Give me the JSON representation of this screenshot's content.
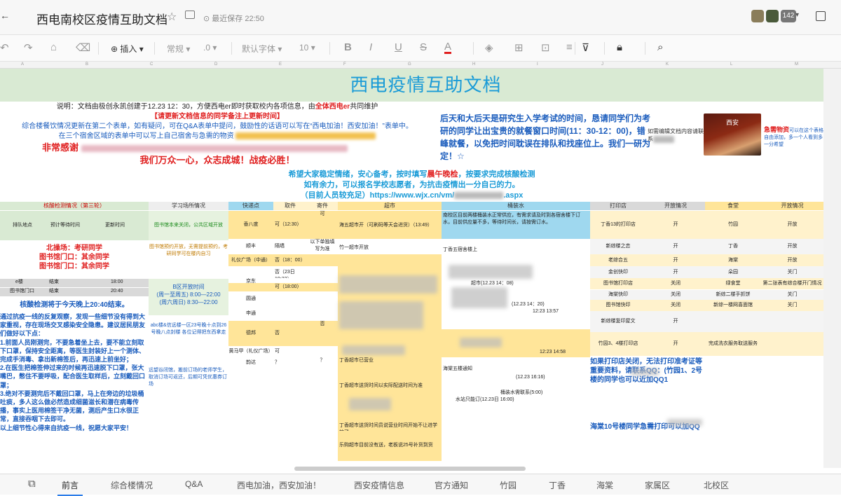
{
  "window": {
    "back": "←",
    "title": "西电南校区疫情互助文档",
    "save_status": "最近保存 22:50",
    "collab_count": "142",
    "dropdown": "▾"
  },
  "toolbar": {
    "insert": "插入",
    "normal": "常规",
    "decimal": ".0",
    "font": "默认字体",
    "size": "10",
    "bold": "B",
    "italic": "I",
    "underline": "U",
    "strike": "S",
    "color": "A"
  },
  "columns": [
    "A",
    "B",
    "C",
    "D",
    "E",
    "F",
    "G",
    "H",
    "I",
    "J",
    "K",
    "L",
    "M"
  ],
  "doc": {
    "banner": "西电疫情互助文档",
    "intro1a": "说明：文档由极创永凯创建于12.23 12：30，方便西电er即时获取校内各项信息，由",
    "intro1b": "全体西电er",
    "intro1c": "共同维护",
    "intro2": "【请更新文档信息的同学备注上更新时间】",
    "intro3": "综合楼餐饮情况更新在第二个表单，如有疑问，可在Q&A表单中提问，鼓励性的话语可以写在“西电加油！西安加油！”表单中。",
    "intro4": "在三个宿舍区域的表单中可以写上自己宿舍与急需的物资",
    "intro5": "非常感谢",
    "intro6": "我们万众一心，众志成城！战疫必胜！",
    "right_notice": "后天和大后天是研究生入学考试的时间，恳请同学们为考研的同学让出宝贵的就餐窗口时间(11：30-12：00)，错峰就餐，以免把时间耽误在排队和找座位上。我们一研为定！☆",
    "contact": "如需编辑文档内容请联系",
    "urgent": "急需物资",
    "urgent_sub": "可以在这个表格自由添加，多一个人看到多一分希望",
    "photo_label": "西安",
    "center1a": "希望大家稳定情绪，安心备考，按时填写",
    "center1b": "晨午晚检",
    "center1c": "，按要求完成核酸检测",
    "center2": "如有余力，可以报名学校志愿者，为抗击疫情出一分自己的力。",
    "center3a": "（目前人员较充足）https://www.wjx.cn/vm/",
    "center3b": ".aspx"
  },
  "headers": {
    "nucleic": "核酸检测情况（第三轮）",
    "study": "学习场所情况",
    "express": "快递点",
    "pickup": "取件",
    "send": "寄件",
    "market": "超市",
    "water": "桶装水",
    "print": "打印店",
    "open1": "开放情况",
    "canteen": "食堂",
    "open2": "开放情况"
  },
  "nucleic": {
    "r1c1": "排队地点",
    "r1c2": "预计等待时间",
    "r1c3": "更新时间",
    "north1": "北操场：考研同学",
    "north2": "图书馆门口：其余同学",
    "north3": "图书馆门口：其余同学",
    "e_bldg": "e楼",
    "e_status": "结束",
    "e_time": "18:00",
    "lib": "图书馆门口",
    "lib_status": "结束",
    "lib_time": "20:40",
    "ended": "核酸检测将于今天晚上20:40结束。",
    "notes": "通过抗疫一线的反复观察，发现一些细节没有得到大家重视，存在现场交叉感染安全隐患。建议居民朋友们做好以下点：\n1.前面人员刚测完，不要急着坐上去，要不能立刻取下口罩，保持安全距离，等医生封装好上一个测体、完成手消毒、拿出新棉签后，再迅速上前坐好；\n2.在医生把棉签伸过来的时候再迅速脱下口罩，张大嘴巴，憋住不要呼吸，配合医生取样后，立刻戴回口罩；\n3.绝对不要测完后不戴回口罩，马上在旁边的垃圾桶吐痰，多人这么做必然造成细菌滋长和潜在病毒传播，事实上医用棉签干净无菌，测后产生口水很正常，直接吞咽下去即可。\n以上细节性心得来自抗疫一线，祝愿大家平安！"
  },
  "study": {
    "s1": "图书馆本来关闭，公共区域开放",
    "s2": "图书馆预约开放，无需提前预约，考研同学可在楼内自习",
    "s3": "B区开放时间",
    "s4": "(周一至周五) 8:00—22:00",
    "s5": "(周六周日) 8:30—22:00",
    "s6": "abc楼&信远楼一区23号晚十点到26号晚八点封楼 各位记得把东西拿走",
    "s7": "远望谷闭馆，搬前订场的老师学生，取消订场可返还，后期可凭优惠券订场"
  },
  "express": {
    "rows": [
      [
        "香八度",
        "可（12:30）",
        "可"
      ],
      [
        "顺丰",
        "隔墙",
        "以下单独填写为准"
      ],
      [
        "礼仪广场（中通）",
        "否（18：00）",
        ""
      ],
      [
        "",
        "否（23日19:22）",
        ""
      ],
      [
        "京东",
        "",
        ""
      ],
      [
        "",
        "可（18:00）",
        ""
      ],
      [
        "圆通",
        "",
        ""
      ],
      [
        "申通",
        "",
        ""
      ],
      [
        "德邦",
        "否",
        "否"
      ],
      [
        "黄马甲（礼仪广场）",
        "可",
        ""
      ],
      [
        "韵达",
        "？",
        "？"
      ]
    ]
  },
  "market": {
    "m1": "海五超市开（可刷码等天会进货）（13:49）",
    "m2": "竹一超市开放",
    "m3": "丁香超市已营业",
    "m4": "丁香超市送货时间以实际配送时间为准",
    "m5": "丁香超市送货时间员说营业时间开始不让进学校了",
    "m6": "乐购超市目前没有送，老板说25号补货到货"
  },
  "water": {
    "w1": "南校区目前两楼桶装水正常供应，有需求请及时到各宿舍楼下订水，目前供应量不多，等待时间长，请按需订水。",
    "w2": "丁香五宿舍楼上",
    "w3": "超市(12.23 14：08)",
    "w4": "(12.23 14：20)",
    "w5": "12:23 13:57",
    "w6": "12:23 14:58",
    "w7": "(12.23 16:16)",
    "w8": "海棠五楼通知",
    "w9": "桶装水需联系(5:00)",
    "w10": "水站只能订(12.23日 16:00)"
  },
  "print": {
    "rows": [
      [
        "丁香13的打印店",
        "开",
        "竹园",
        "开放"
      ],
      [
        "新综楼之恋",
        "开",
        "丁香",
        "开放"
      ],
      [
        "老综合五",
        "开",
        "海棠",
        "开放"
      ],
      [
        "金创快印",
        "开",
        "朵园",
        "关门"
      ],
      [
        "图书馆打印店",
        "关闭",
        "绿食堂",
        "第二张表有综合楼开门情况"
      ],
      [
        "海棠快印",
        "关闭",
        "新综二楼手抓饼",
        "关门"
      ],
      [
        "图书馆快印",
        "关闭",
        "新综一楼网喜面馆",
        "关门"
      ],
      [
        "新综楼复印屋文",
        "开",
        "",
        ""
      ],
      [
        "竹园3、4楼打印店",
        "开",
        "完成洗衣服务取送服务",
        ""
      ]
    ],
    "note1": "如果打印店关闭，无法打印准考证等重要资料，请联系QQ：(竹园1、2号楼的同学也可以近加QQ1",
    "note2": "海棠10号楼同学急需打印可以加QQ"
  },
  "tabs": [
    "前言",
    "综合楼情况",
    "Q&A",
    "西电加油，西安加油！",
    "西安疫情信息",
    "官方通知",
    "竹园",
    "丁香",
    "海棠",
    "家属区",
    "北校区"
  ]
}
